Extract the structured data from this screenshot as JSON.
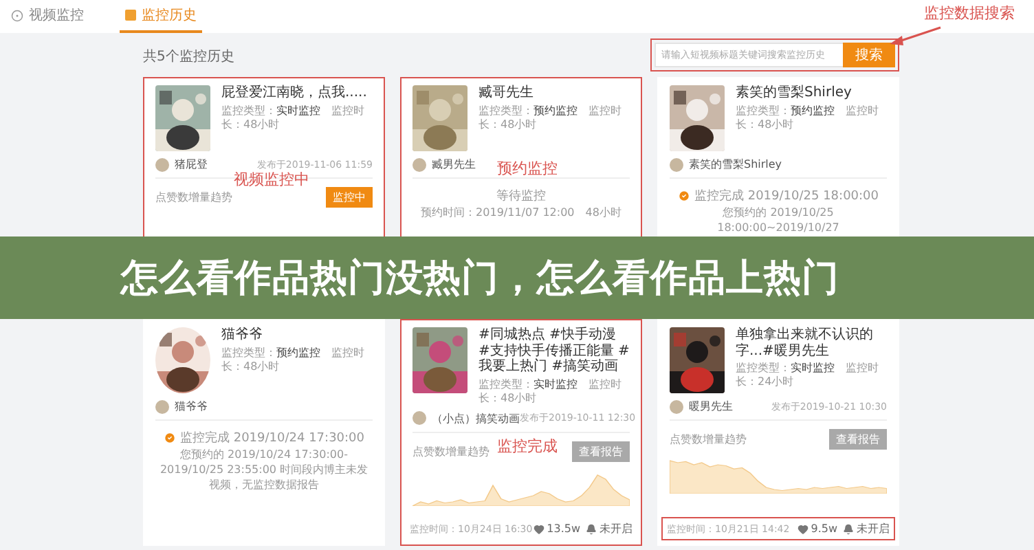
{
  "nav": {
    "tabs": [
      {
        "label": "视频监控",
        "selected": false
      },
      {
        "label": "监控历史",
        "selected": true
      }
    ]
  },
  "count_label": "共5个监控历史",
  "search": {
    "placeholder": "请输入短视频标题关键词搜索监控历史",
    "button": "搜索",
    "annotated": true
  },
  "search_annotation": "监控数据搜索",
  "cards": [
    {
      "kind": "monitoring",
      "title": "屁登爱江南晓，点我.....",
      "meta": "监控类型：**实时监控**　监控时长：48小时",
      "author": "猪屁登",
      "published": "发布于2019-11-06 11:59",
      "annotated": true,
      "note": "视频监控中",
      "trend_label": "点赞数增量趋势",
      "button": "监控中"
    },
    {
      "kind": "waiting",
      "title": "臧哥先生",
      "meta": "监控类型：**预约监控**　监控时长：48小时",
      "author": "臧男先生",
      "annotated": true,
      "note": "预约监控",
      "status": "等待监控",
      "detail": "预约时间：2019/11/07 12:00　48小时"
    },
    {
      "kind": "finished",
      "title": "素笑的雪梨Shirley",
      "meta": "监控类型：**预约监控**　监控时长：48小时",
      "author": "素笑的雪梨Shirley",
      "annotated": false,
      "status": "监控完成 2019/10/25 18:00:00",
      "detail": "您预约的 2019/10/25 18:00:00~2019/10/27"
    },
    {
      "kind": "finished",
      "title": "猫爷爷",
      "meta": "监控类型：**预约监控**　监控时长：48小时",
      "author": "猫爷爷",
      "annotated": false,
      "status": "监控完成 2019/10/24 17:30:00",
      "detail": "您预约的 2019/10/24 17:30:00-2019/10/25 23:55:00 时间段内博主未发视频，无监控数据报告"
    },
    {
      "kind": "chart",
      "title": "#同城热点 #快手动漫 #支持快手传播正能量 #我要上热门 #搞笑动画",
      "meta": "监控类型：**实时监控**　监控时长：48小时",
      "author": "（小点）搞笑动画",
      "published": "发布于2019-10-11 12:30",
      "annotated": true,
      "note": "监控完成",
      "trend_label": "点赞数增量趋势",
      "button": "查看报告",
      "monitor_time": "监控时间：10月24日 16:30",
      "likes": "13.5w",
      "alert": "未开启",
      "footer_annotated": false
    },
    {
      "kind": "chart",
      "title": "单独拿出来就不认识的字...#暖男先生",
      "meta": "监控类型：**实时监控**　监控时长：24小时",
      "author": "暖男先生",
      "published": "发布于2019-10-21 10:30",
      "annotated": false,
      "trend_label": "点赞数增量趋势",
      "button": "查看报告",
      "monitor_time": "监控时间：10月21日 14:42",
      "likes": "9.5w",
      "alert": "未开启",
      "footer_annotated": true
    }
  ],
  "banner": "怎么看作品热门没热门，怎么看作品上热门"
}
